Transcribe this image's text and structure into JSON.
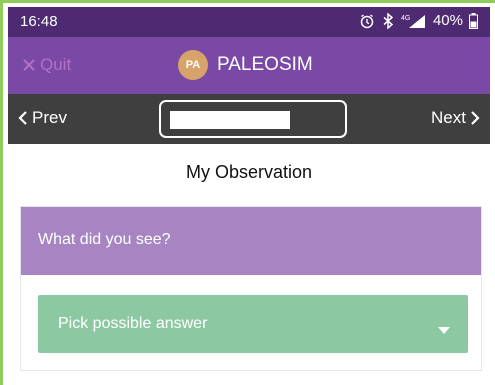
{
  "statusbar": {
    "time": "16:48",
    "signal_label": "4G",
    "battery": "40%",
    "icons": [
      "alarm-icon",
      "bluetooth-icon",
      "signal-icon",
      "battery-icon"
    ]
  },
  "appbar": {
    "quit_label": "Quit",
    "logo_text": "PA",
    "app_name": "PALEOSIM"
  },
  "navbar": {
    "prev_label": "Prev",
    "next_label": "Next"
  },
  "main": {
    "title": "My Observation",
    "question": "What did you see?",
    "select_placeholder": "Pick possible answer"
  },
  "colors": {
    "status_bg": "#4e2a72",
    "appbar_bg": "#7a49a6",
    "navbar_bg": "#3f3f3f",
    "question_bg": "#a785c2",
    "select_bg": "#8cc9a3",
    "logo_bg": "#d8a36a"
  }
}
